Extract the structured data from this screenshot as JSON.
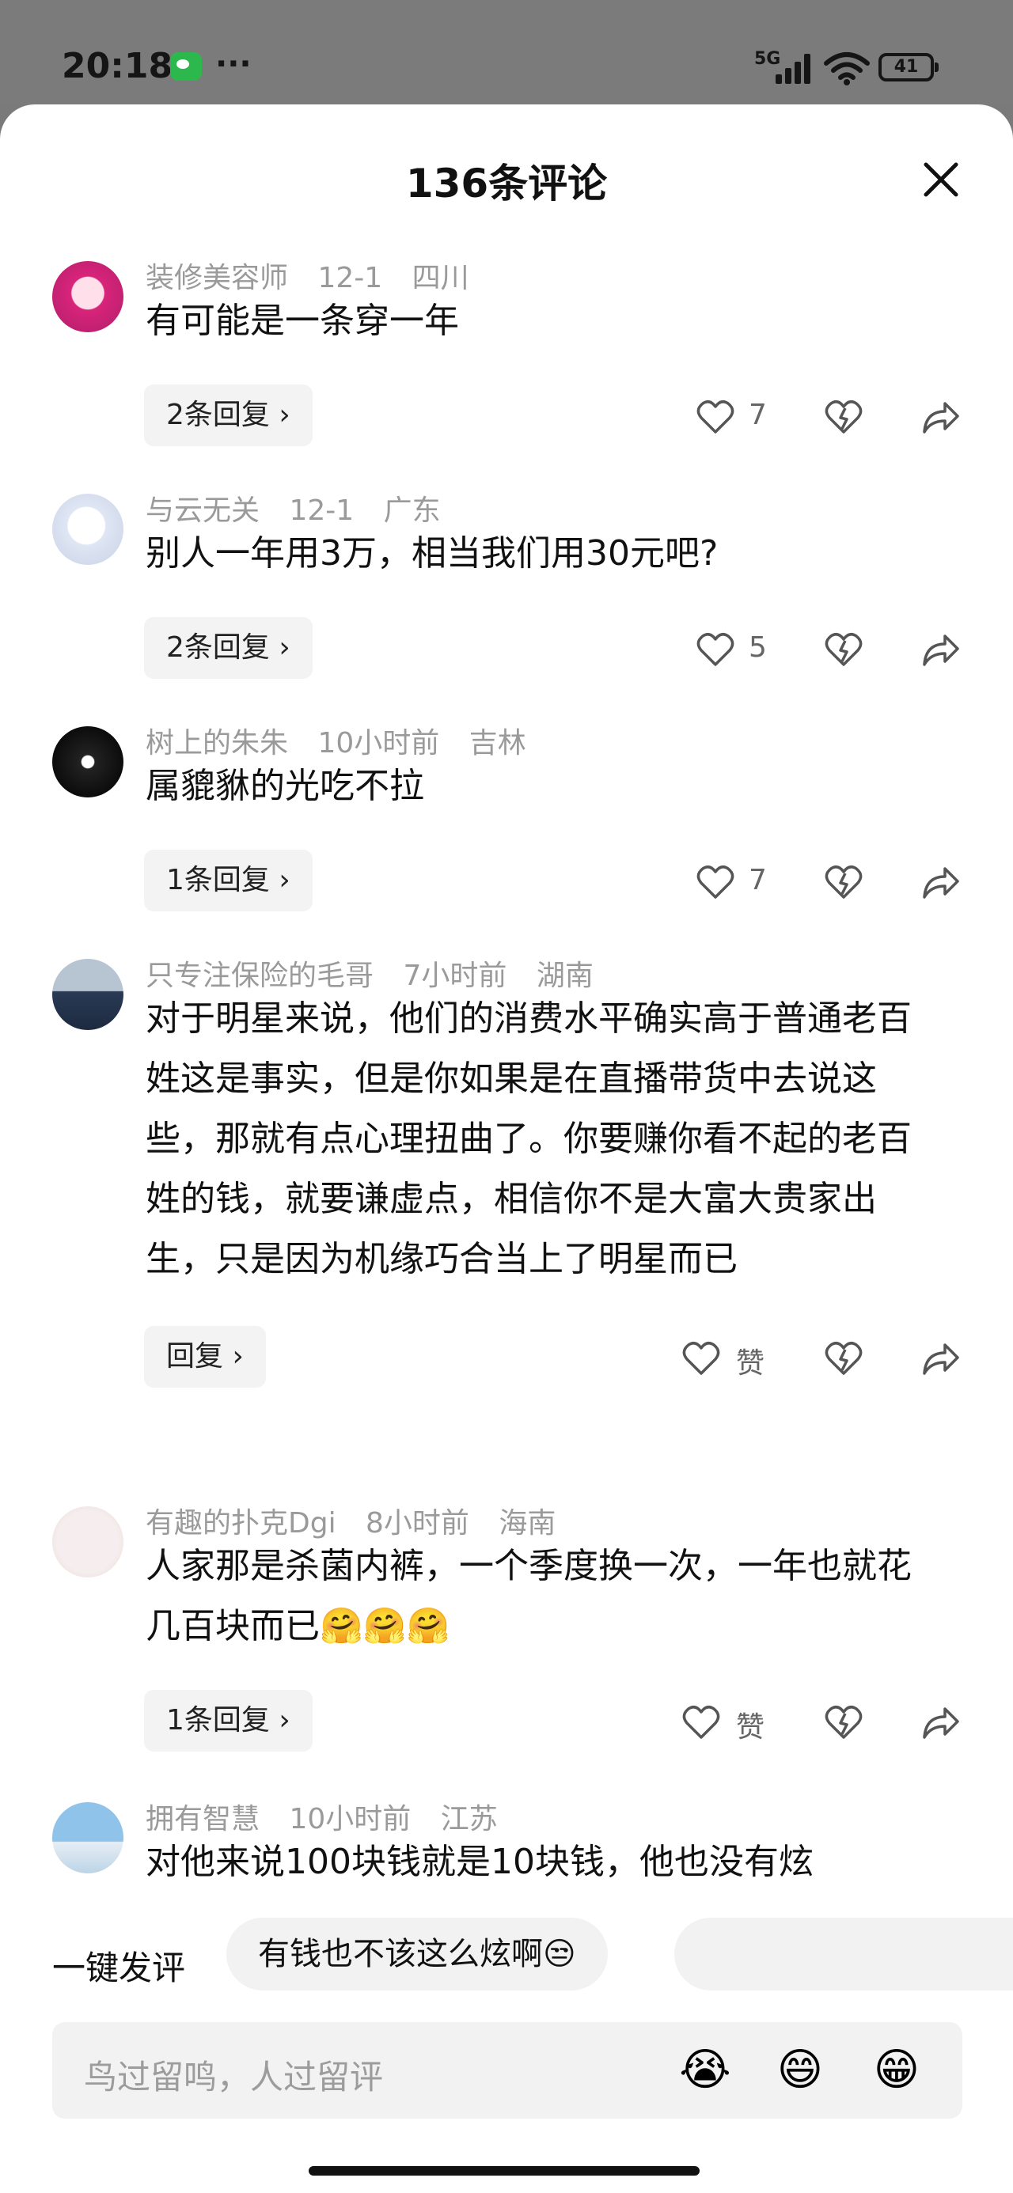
{
  "status_bar": {
    "time": "20:18",
    "network": "5G",
    "battery": "41"
  },
  "sheet": {
    "title": "136条评论"
  },
  "comments": [
    {
      "username": "装修美容师",
      "date": "12-1",
      "location": "四川",
      "text": "有可能是一条穿一年",
      "reply_label": "2条回复 ›",
      "likes": "7"
    },
    {
      "username": "与云无关",
      "date": "12-1",
      "location": "广东",
      "text": "别人一年用3万，相当我们用30元吧?",
      "reply_label": "2条回复 ›",
      "likes": "5"
    },
    {
      "username": "树上的朱朱",
      "date": "10小时前",
      "location": "吉林",
      "text": "属貔貅的光吃不拉",
      "reply_label": "1条回复 ›",
      "likes": "7"
    },
    {
      "username": "只专注保险的毛哥",
      "date": "7小时前",
      "location": "湖南",
      "text": "对于明星来说，他们的消费水平确实高于普通老百姓这是事实，但是你如果是在直播带货中去说这些，那就有点心理扭曲了。你要赚你看不起的老百姓的钱，就要谦虚点，相信你不是大富大贵家出生，只是因为机缘巧合当上了明星而已",
      "reply_label": "回复 ›",
      "likes": "赞"
    },
    {
      "username": "有趣的扑克Dgi",
      "date": "8小时前",
      "location": "海南",
      "text": "人家那是杀菌内裤，一个季度换一次，一年也就花几百块而已🤗🤗🤗",
      "reply_label": "1条回复 ›",
      "likes": "赞"
    },
    {
      "username": "拥有智慧",
      "date": "10小时前",
      "location": "江苏",
      "text": "对他来说100块钱就是10块钱，他也没有炫"
    }
  ],
  "quick_comment": {
    "label": "一键发评",
    "chips": [
      "有钱也不该这么炫啊😒"
    ]
  },
  "input": {
    "placeholder": "鸟过留鸣，人过留评",
    "emojis": [
      "😭",
      "😄",
      "😁"
    ]
  }
}
